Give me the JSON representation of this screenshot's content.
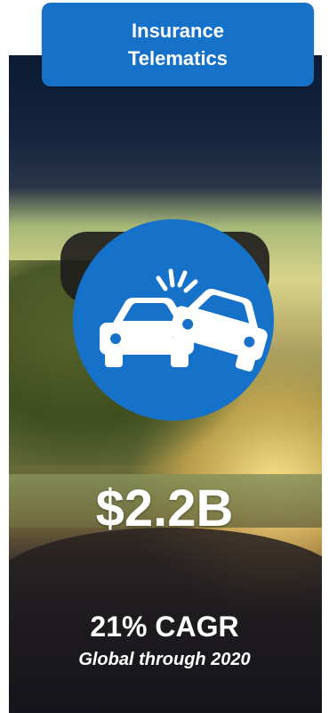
{
  "header": {
    "title_line1": "Insurance",
    "title_line2": "Telematics"
  },
  "icon": {
    "name": "car-crash-icon",
    "circle_color": "#1671c9"
  },
  "stats": {
    "value": "$2.2B",
    "growth": "21% CAGR",
    "note": "Global through 2020"
  }
}
